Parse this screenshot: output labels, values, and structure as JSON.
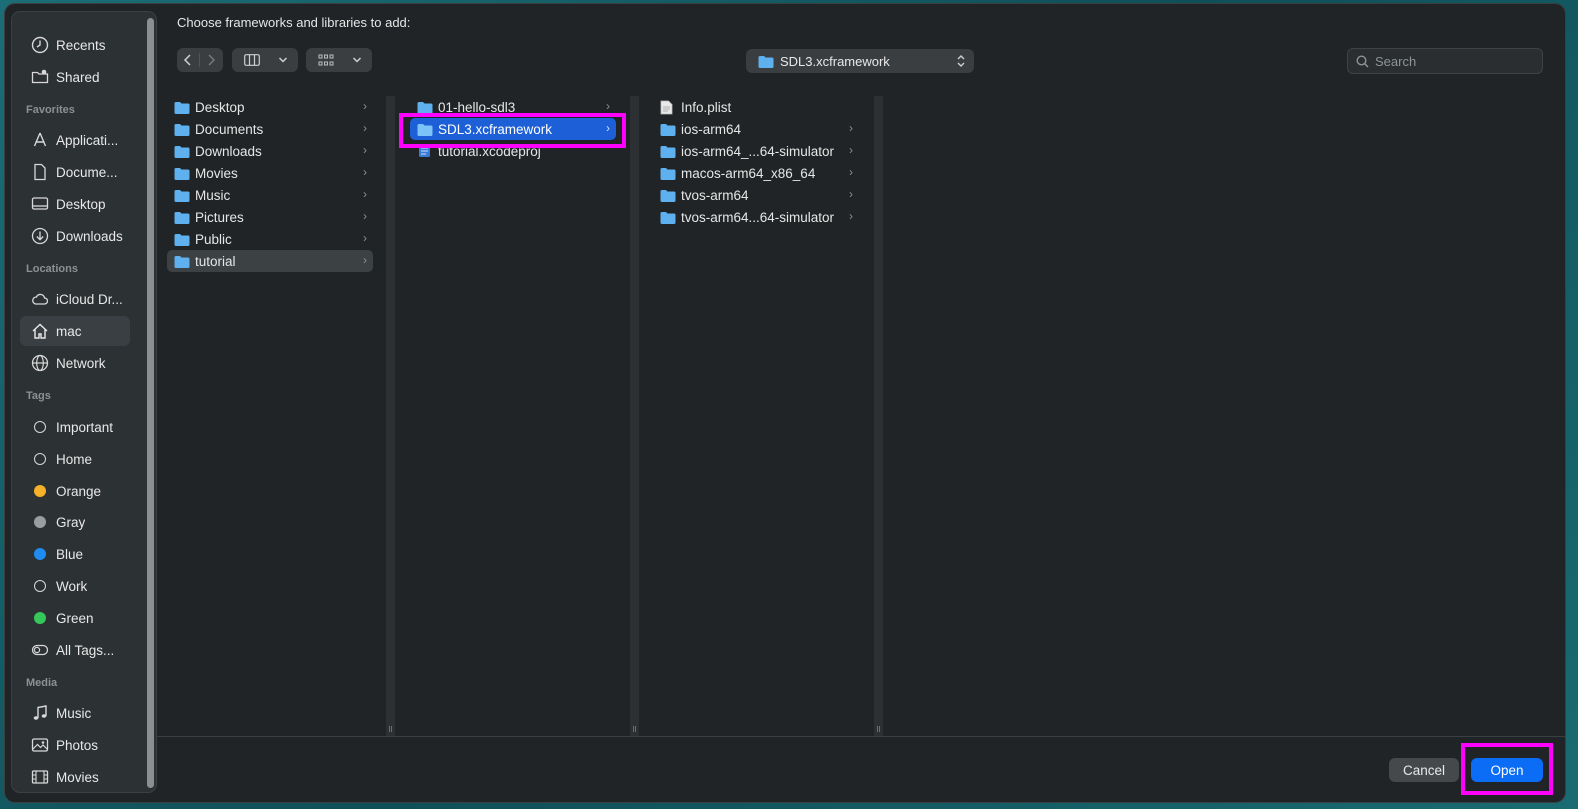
{
  "dialog": {
    "prompt": "Choose frameworks and libraries to add:"
  },
  "sidebar": {
    "recents": "Recents",
    "shared": "Shared",
    "favorites_header": "Favorites",
    "favorites": [
      "Applicati...",
      "Docume...",
      "Desktop",
      "Downloads"
    ],
    "locations_header": "Locations",
    "locations": [
      "iCloud Dr...",
      "mac",
      "Network"
    ],
    "tags_header": "Tags",
    "tags": [
      {
        "label": "Important",
        "color": "ring"
      },
      {
        "label": "Home",
        "color": "ring"
      },
      {
        "label": "Orange",
        "color": "#f6b02a"
      },
      {
        "label": "Gray",
        "color": "#9a9ea1"
      },
      {
        "label": "Blue",
        "color": "#1e8cf0"
      },
      {
        "label": "Work",
        "color": "ring"
      },
      {
        "label": "Green",
        "color": "#35c759"
      },
      {
        "label": "All Tags...",
        "color": "alltags"
      }
    ],
    "media_header": "Media",
    "media": [
      "Music",
      "Photos",
      "Movies"
    ]
  },
  "toolbar": {
    "path_label": "SDL3.xcframework",
    "search_placeholder": "Search"
  },
  "columns": {
    "col1": [
      "Desktop",
      "Documents",
      "Downloads",
      "Movies",
      "Music",
      "Pictures",
      "Public",
      "tutorial"
    ],
    "col2": [
      "01-hello-sdl3",
      "SDL3.xcframework",
      "tutorial.xcodeproj"
    ],
    "col3": [
      "Info.plist",
      "ios-arm64",
      "ios-arm64_...64-simulator",
      "macos-arm64_x86_64",
      "tvos-arm64",
      "tvos-arm64...64-simulator"
    ]
  },
  "footer": {
    "cancel_label": "Cancel",
    "open_label": "Open"
  },
  "colors": {
    "accent": "#0b6cf5",
    "selection": "#1c5fd6",
    "highlight": "#ff00ff",
    "folder": "#5fb0ef"
  }
}
